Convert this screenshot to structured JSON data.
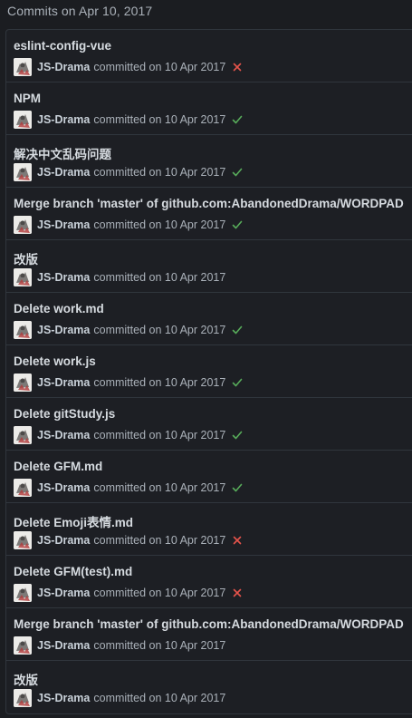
{
  "header": {
    "title": "Commits on Apr 10, 2017"
  },
  "colors": {
    "success": "#57ab5a",
    "failure": "#e5534b"
  },
  "commits": [
    {
      "message": "eslint-config-vue",
      "author": "JS-Drama",
      "action": "committed on 10 Apr 2017",
      "status": "failure",
      "status_icon": "x-icon"
    },
    {
      "message": "NPM",
      "author": "JS-Drama",
      "action": "committed on 10 Apr 2017",
      "status": "success",
      "status_icon": "check-icon"
    },
    {
      "message": "解决中文乱码问题",
      "author": "JS-Drama",
      "action": "committed on 10 Apr 2017",
      "status": "success",
      "status_icon": "check-icon"
    },
    {
      "message": "Merge branch 'master' of github.com:AbandonedDrama/WORDPAD",
      "author": "JS-Drama",
      "action": "committed on 10 Apr 2017",
      "status": "success",
      "status_icon": "check-icon"
    },
    {
      "message": "改版",
      "author": "JS-Drama",
      "action": "committed on 10 Apr 2017",
      "status": "none",
      "status_icon": ""
    },
    {
      "message": "Delete work.md",
      "author": "JS-Drama",
      "action": "committed on 10 Apr 2017",
      "status": "success",
      "status_icon": "check-icon"
    },
    {
      "message": "Delete work.js",
      "author": "JS-Drama",
      "action": "committed on 10 Apr 2017",
      "status": "success",
      "status_icon": "check-icon"
    },
    {
      "message": "Delete gitStudy.js",
      "author": "JS-Drama",
      "action": "committed on 10 Apr 2017",
      "status": "success",
      "status_icon": "check-icon"
    },
    {
      "message": "Delete GFM.md",
      "author": "JS-Drama",
      "action": "committed on 10 Apr 2017",
      "status": "success",
      "status_icon": "check-icon"
    },
    {
      "message": "Delete Emoji表情.md",
      "author": "JS-Drama",
      "action": "committed on 10 Apr 2017",
      "status": "failure",
      "status_icon": "x-icon"
    },
    {
      "message": "Delete GFM(test).md",
      "author": "JS-Drama",
      "action": "committed on 10 Apr 2017",
      "status": "failure",
      "status_icon": "x-icon"
    },
    {
      "message": "Merge branch 'master' of github.com:AbandonedDrama/WORDPAD",
      "author": "JS-Drama",
      "action": "committed on 10 Apr 2017",
      "status": "none",
      "status_icon": ""
    },
    {
      "message": "改版",
      "author": "JS-Drama",
      "action": "committed on 10 Apr 2017",
      "status": "none",
      "status_icon": ""
    }
  ]
}
